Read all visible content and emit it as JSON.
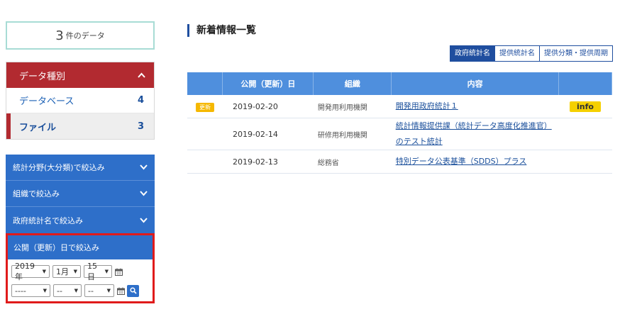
{
  "summary": {
    "count": "3",
    "unit": "件のデータ"
  },
  "category": {
    "title": "データ種別",
    "items": [
      {
        "label": "データベース",
        "count": "4"
      },
      {
        "label": "ファイル",
        "count": "3"
      }
    ]
  },
  "filters": [
    {
      "label": "統計分野(大分類)で絞込み"
    },
    {
      "label": "組織で絞込み"
    },
    {
      "label": "政府統計名で絞込み"
    }
  ],
  "date_filter": {
    "title": "公開（更新）日で絞込み",
    "from": {
      "year": "2019年",
      "month": "1月",
      "day": "15日"
    },
    "to": {
      "year": "----",
      "month": "--",
      "day": "--"
    }
  },
  "main": {
    "title": "新着情報一覧",
    "sort": [
      "政府統計名",
      "提供統計名",
      "提供分類・提供周期"
    ],
    "columns": [
      "",
      "公開（更新）日",
      "組織",
      "内容",
      ""
    ],
    "rows": [
      {
        "badge": "更新",
        "date": "2019-02-20",
        "org": "開発用利用機関",
        "content_1": "開発用政府統計１",
        "content_2": "",
        "info": "info"
      },
      {
        "badge": "",
        "date": "2019-02-14",
        "org": "研修用利用機関",
        "content_1": "統計情報提供課（統計データ高度化推進官）",
        "content_2": "のテスト統計",
        "info": ""
      },
      {
        "badge": "",
        "date": "2019-02-13",
        "org": "総務省",
        "content_1": "特別データ公表基準（SDDS）プラス",
        "content_2": "",
        "info": ""
      }
    ]
  }
}
